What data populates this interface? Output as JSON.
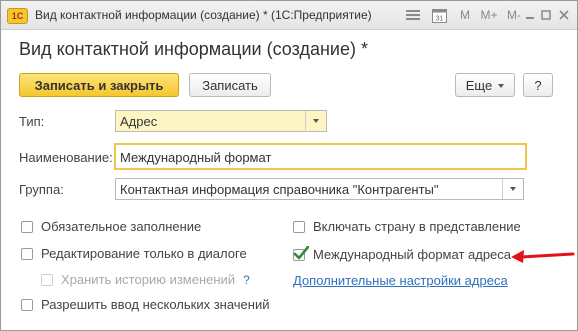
{
  "window": {
    "app_logo": "1С",
    "title": "Вид контактной информации (создание) * (1С:Предприятие)",
    "icons": [
      "menu-icon",
      "calendar-icon",
      "memory-m-label",
      "memory-m-plus-label",
      "memory-m-minus-label",
      "minimize-icon",
      "maximize-icon",
      "close-icon"
    ],
    "icon_texts": {
      "calendar": "31",
      "m": "M",
      "m_plus": "M+",
      "m_minus": "M-"
    }
  },
  "form": {
    "title": "Вид контактной информации (создание) *"
  },
  "toolbar": {
    "save_close_label": "Записать и закрыть",
    "save_label": "Записать",
    "more_label": "Еще",
    "help_label": "?"
  },
  "fields": {
    "type": {
      "label": "Тип:",
      "value": "Адрес"
    },
    "name": {
      "label": "Наименование:",
      "value": "Международный формат"
    },
    "group": {
      "label": "Группа:",
      "value": "Контактная информация справочника \"Контрагенты\""
    }
  },
  "options": {
    "required_fill": {
      "label": "Обязательное заполнение",
      "checked": false
    },
    "dialog_only_edit": {
      "label": "Редактирование только в диалоге",
      "checked": false
    },
    "store_history": {
      "label": "Хранить историю изменений",
      "checked": false,
      "disabled": true,
      "help": "?"
    },
    "multiple_values": {
      "label": "Разрешить ввод нескольких значений",
      "checked": false
    },
    "include_country": {
      "label": "Включать страну в представление",
      "checked": false
    },
    "intl_format": {
      "label": "Международный формат адреса",
      "checked": true
    }
  },
  "links": {
    "additional_settings": "Дополнительные настройки адреса"
  },
  "colors": {
    "primary_button": "#f5c72c",
    "focused_border": "#f0c64a",
    "checkmark": "#2e8b3a",
    "arrow": "#e3121a",
    "link": "#2f6fbf"
  }
}
